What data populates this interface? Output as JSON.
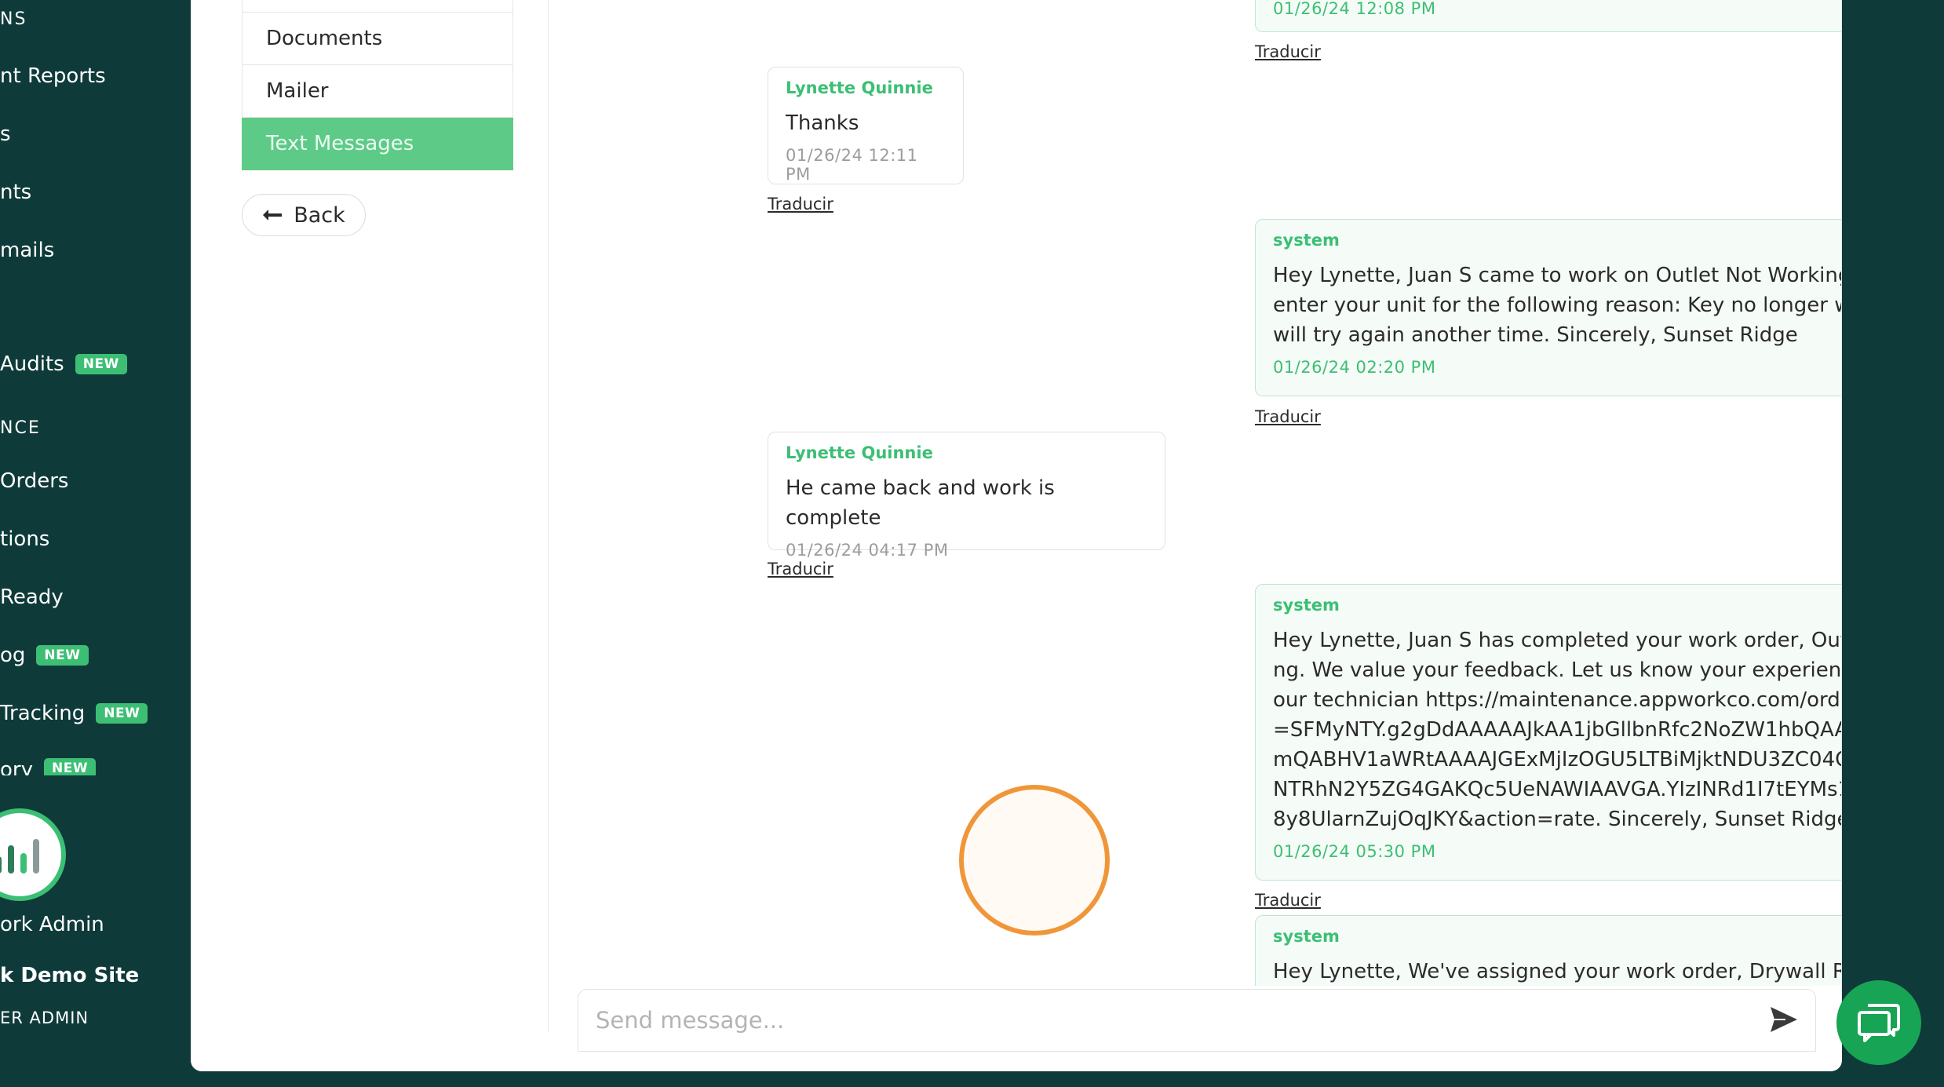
{
  "sidebar": {
    "items": [
      {
        "label": "NS",
        "badge": ""
      },
      {
        "label": "nt Reports",
        "badge": ""
      },
      {
        "label": "s",
        "badge": ""
      },
      {
        "label": "nts",
        "badge": ""
      },
      {
        "label": "mails",
        "badge": ""
      },
      {
        "label": "Audits",
        "badge": "NEW"
      },
      {
        "label": "NCE",
        "badge": ""
      },
      {
        "label": "Orders",
        "badge": ""
      },
      {
        "label": "tions",
        "badge": ""
      },
      {
        "label": "Ready",
        "badge": ""
      },
      {
        "label": "og",
        "badge": "NEW"
      },
      {
        "label": "Tracking",
        "badge": "NEW"
      },
      {
        "label": "ory",
        "badge": "NEW"
      }
    ],
    "user_name": "ork Admin",
    "site_name": "k Demo Site",
    "role": "ER ADMIN"
  },
  "subnav": {
    "items": [
      "Documents",
      "Mailer",
      "Text Messages"
    ],
    "active": "Text Messages",
    "back_label": "Back"
  },
  "messages": [
    {
      "sender": "",
      "body": "",
      "time": "01/26/24 12:08 PM",
      "system": true,
      "translate": "Traducir"
    },
    {
      "sender": "Lynette Quinnie",
      "body": "Thanks",
      "time": "01/26/24 12:11 PM",
      "system": false,
      "translate": "Traducir"
    },
    {
      "sender": "system",
      "body": "Hey Lynette, Juan S came to work on Outlet Not Working. but couldn't enter your unit for the following reason: Key no longer works. Juan will try again another time. Sincerely, Sunset Ridge",
      "time": "01/26/24 02:20 PM",
      "system": true,
      "translate": "Traducir"
    },
    {
      "sender": "Lynette Quinnie",
      "body": "He came back and work is complete",
      "time": "01/26/24 04:17 PM",
      "system": false,
      "translate": "Traducir"
    },
    {
      "sender": "system",
      "body": "Hey Lynette, Juan S has completed your work order, Outlet Not Working. We value your feedback. Let us know your experience by rating your technician https://maintenance.appworkco.com/orders/rate?token=SFMyNTY.g2gDdAAAAAJkAA1jbGllbnRfc2NoZW1hbQAAAAVhZnRvbmQABHV1aWRtAAAAJGExMjIzOGU5LTBiMjktNDU3ZC04ODMxLTJlOTIwNTRhN2Y5ZG4GAKQc5UeNAWIAAVGA.YIzINRd1I7tEYMs1rJb_RQN7Avr8y8UlarnZujOqJKY&action=rate. Sincerely, Sunset Ridge",
      "time": "01/26/24 05:30 PM",
      "system": true,
      "translate": "Traducir"
    },
    {
      "sender": "system",
      "body": "Hey Lynette, We've assigned your work order, Drywall Repairs, to",
      "time": "",
      "system": true,
      "translate": ""
    }
  ],
  "composer": {
    "placeholder": "Send message..."
  },
  "colors": {
    "sidebar_bg": "#0f3a3a",
    "accent_green": "#3cbf74",
    "active_tab": "#5dcb87",
    "fab": "#17a455",
    "click_ring": "#f0963a"
  },
  "icons": {
    "back": "arrow-left-icon",
    "send": "send-icon",
    "chat": "chat-bubbles-icon",
    "avatar": "bar-chart-icon"
  }
}
